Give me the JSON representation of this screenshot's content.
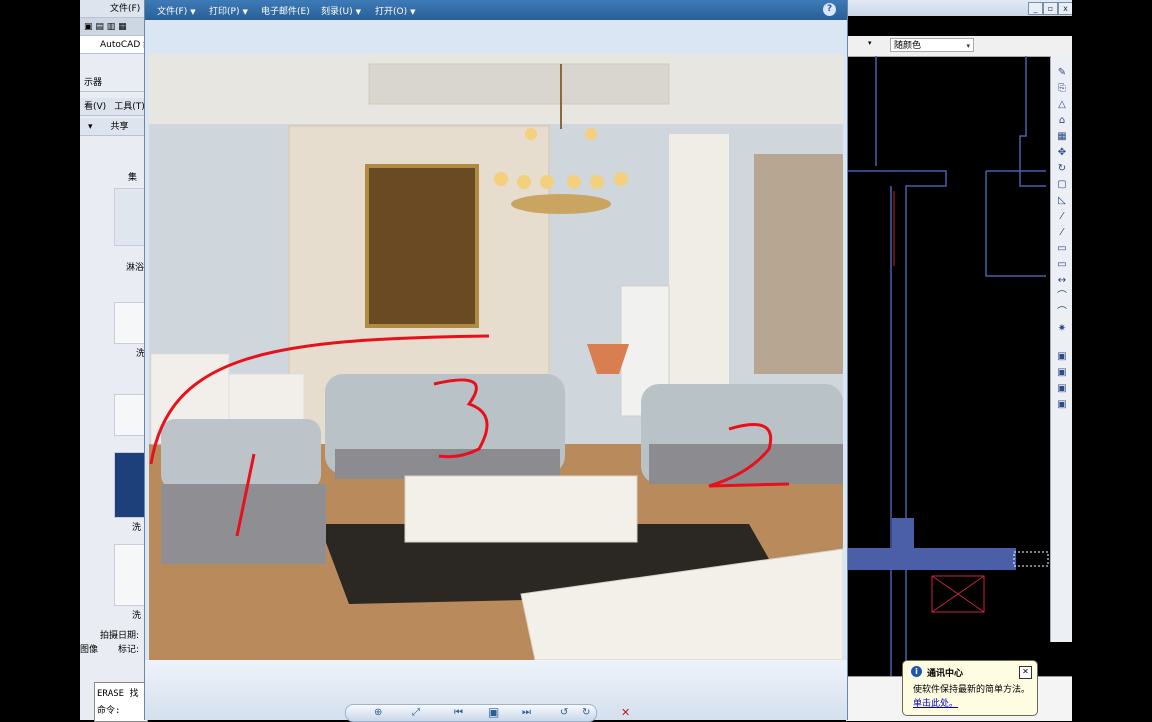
{
  "left_strip": {
    "menu_file": "文件(F)",
    "autocad_tab": "AutoCAD 经",
    "viewer_label": "示器",
    "menu_view": "看(V)",
    "menu_tools": "工具(T)",
    "share": "共享",
    "items": [
      "集",
      "淋浴",
      "洗",
      "洗",
      "洗"
    ],
    "capture_date": "拍摄日期:",
    "image_label": "图像",
    "tags_label": "标记:",
    "cmd_erase": "ERASE 找",
    "cmd_prompt": "命令:"
  },
  "viewer": {
    "menu": [
      {
        "label": "文件(F)"
      },
      {
        "label": "打印(P)"
      },
      {
        "label": "电子邮件(E)"
      },
      {
        "label": "刻录(U)"
      },
      {
        "label": "打开(O)"
      }
    ],
    "help": "?",
    "annotations": [
      "1",
      "2",
      "3"
    ],
    "controls": [
      "⊕",
      "⤢",
      "⏮",
      "▣",
      "⏭",
      "↺",
      "↻",
      "✕"
    ]
  },
  "autocad": {
    "color_value": "随颜色",
    "window_buttons": [
      "_",
      "▫",
      "x"
    ]
  },
  "notification": {
    "title": "通讯中心",
    "body": "使软件保持最新的简单方法。",
    "link": "单击此处。"
  },
  "colors": {
    "accent": "#2a5f97",
    "annotation": "#e8111b",
    "cad_blue": "#4b5fa8"
  }
}
